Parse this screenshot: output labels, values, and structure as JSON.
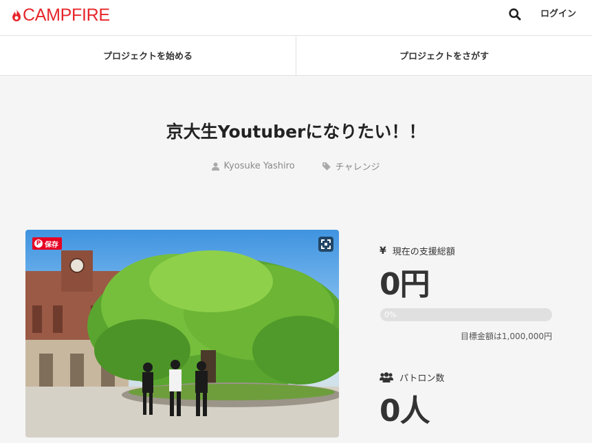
{
  "header": {
    "logo_text": "CAMPFIRE",
    "login_label": "ログイン"
  },
  "subnav": {
    "start_project": "プロジェクトを始める",
    "find_project": "プロジェクトをさがす"
  },
  "project": {
    "title": "京大生Youtuberになりたい！！",
    "author": "Kyosuke Yashiro",
    "category": "チャレンジ"
  },
  "image": {
    "pinterest_save_label": "保存"
  },
  "stats": {
    "funding_label": "現在の支援総額",
    "funding_value": "0円",
    "progress_percent": 0,
    "progress_text": "0%",
    "goal_text": "目標金額は1,000,000円",
    "patrons_label": "パトロン数",
    "patrons_value": "0人"
  },
  "colors": {
    "brand": "#e6252a",
    "pinterest": "#e60023"
  },
  "icons": {
    "logo": "flame-icon",
    "search": "search-icon",
    "author": "user-icon",
    "category": "tag-icon",
    "funding": "yen-icon",
    "patrons": "users-icon"
  }
}
